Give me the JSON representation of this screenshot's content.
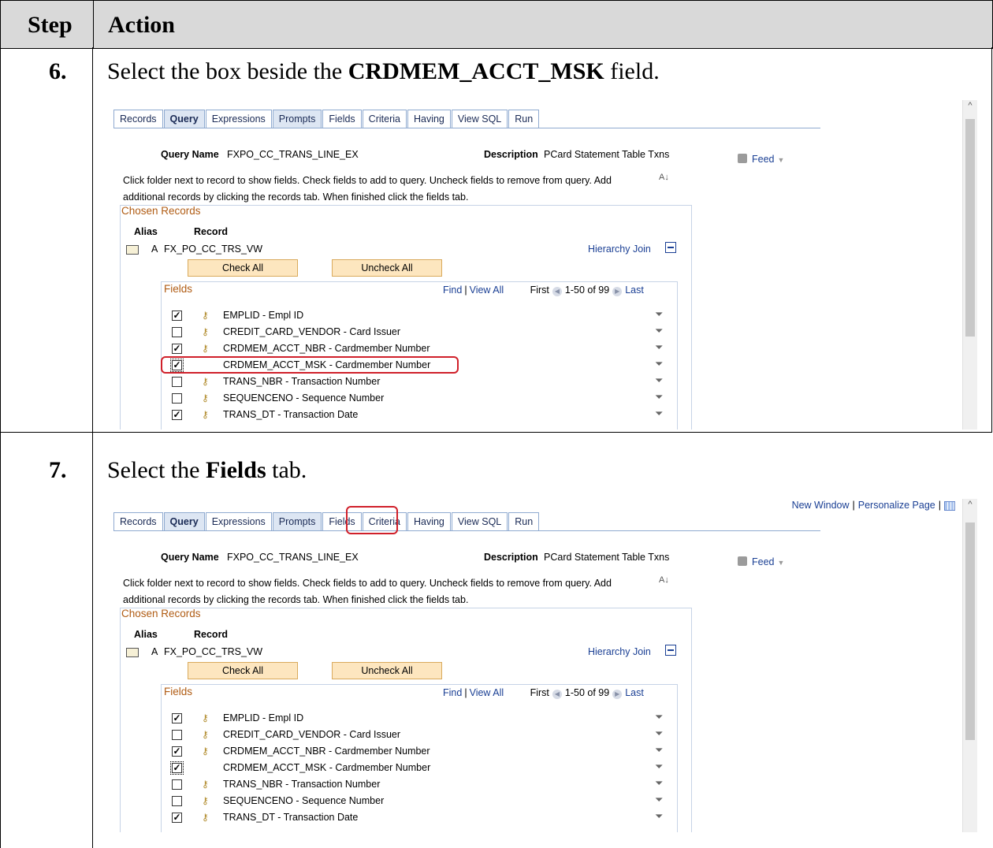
{
  "header": {
    "step": "Step",
    "action": "Action"
  },
  "steps": [
    {
      "number": "6.",
      "text_before": "Select the box beside the ",
      "text_bold": "CRDMEM_ACCT_MSK",
      "text_after": " field."
    },
    {
      "number": "7.",
      "text_before": "Select the ",
      "text_bold": "Fields",
      "text_after": " tab."
    }
  ],
  "shot": {
    "top_links": {
      "new_window": "New Window",
      "separator": "|",
      "personalize": "Personalize Page",
      "table_icon": "table-icon"
    },
    "tabs": [
      "Records",
      "Query",
      "Expressions",
      "Prompts",
      "Fields",
      "Criteria",
      "Having",
      "View SQL",
      "Run"
    ],
    "active_tab": "Query",
    "query_name_label": "Query Name",
    "query_name_value": "FXPO_CC_TRANS_LINE_EX",
    "description_label": "Description",
    "description_value": "PCard Statement Table Txns",
    "feed_label": "Feed",
    "instructions_line1": "Click folder next to record to show fields. Check fields to add to query. Uncheck fields to remove from query. Add",
    "instructions_line2": "additional records by clicking the records tab. When finished click the fields tab.",
    "chosen_records_title": "Chosen Records",
    "alias_header": "Alias",
    "record_header": "Record",
    "record_alias": "A",
    "record_name": "FX_PO_CC_TRS_VW",
    "hierarchy_join": "Hierarchy Join",
    "check_all": "Check All",
    "uncheck_all": "Uncheck All",
    "fields_title": "Fields",
    "find": "Find",
    "view_all": "View All",
    "first": "First",
    "range": "1-50 of 99",
    "last": "Last",
    "fields": [
      {
        "label": "EMPLID - Empl ID",
        "checked": true,
        "key": true
      },
      {
        "label": "CREDIT_CARD_VENDOR - Card Issuer",
        "checked": false,
        "key": true
      },
      {
        "label": "CRDMEM_ACCT_NBR - Cardmember Number",
        "checked": true,
        "key": true
      },
      {
        "label": "CRDMEM_ACCT_MSK - Cardmember Number",
        "checked": true,
        "key": false
      },
      {
        "label": "TRANS_NBR - Transaction Number",
        "checked": false,
        "key": true
      },
      {
        "label": "SEQUENCENO - Sequence Number",
        "checked": false,
        "key": true
      },
      {
        "label": "TRANS_DT - Transaction Date",
        "checked": true,
        "key": true
      }
    ]
  }
}
